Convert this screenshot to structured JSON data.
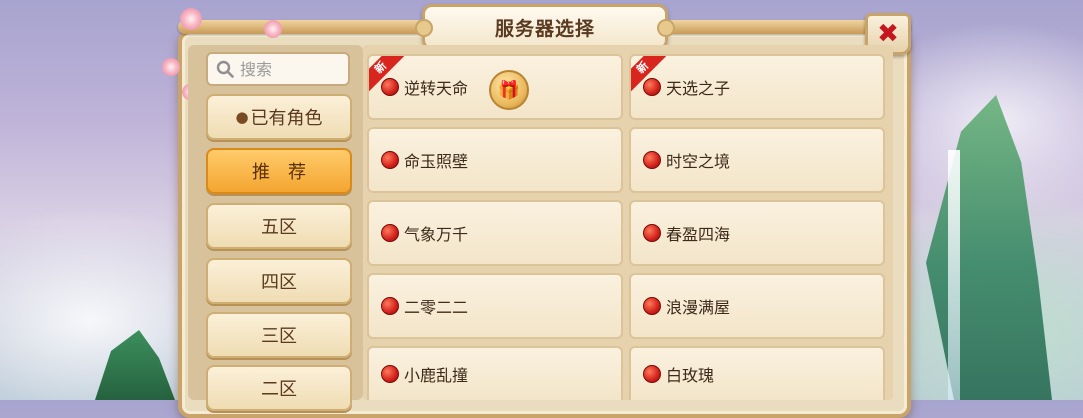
{
  "title": "服务器选择",
  "close_icon": "close-x-icon",
  "search": {
    "placeholder": "搜索",
    "icon": "search-icon"
  },
  "categories": [
    {
      "label": "已有角色",
      "icon": "user-icon",
      "active": false
    },
    {
      "label": "推　荐",
      "active": true
    },
    {
      "label": "五区",
      "active": false
    },
    {
      "label": "四区",
      "active": false
    },
    {
      "label": "三区",
      "active": false
    },
    {
      "label": "二区",
      "active": false
    }
  ],
  "servers": [
    {
      "name": "逆转天命",
      "new": true,
      "gift": true,
      "status": "red"
    },
    {
      "name": "天选之子",
      "new": true,
      "gift": false,
      "status": "red"
    },
    {
      "name": "命玉照壁",
      "new": false,
      "gift": false,
      "status": "red"
    },
    {
      "name": "时空之境",
      "new": false,
      "gift": false,
      "status": "red"
    },
    {
      "name": "气象万千",
      "new": false,
      "gift": false,
      "status": "red"
    },
    {
      "name": "春盈四海",
      "new": false,
      "gift": false,
      "status": "red"
    },
    {
      "name": "二零二二",
      "new": false,
      "gift": false,
      "status": "red"
    },
    {
      "name": "浪漫满屋",
      "new": false,
      "gift": false,
      "status": "red"
    },
    {
      "name": "小鹿乱撞",
      "new": false,
      "gift": false,
      "status": "red"
    },
    {
      "name": "白玫瑰",
      "new": false,
      "gift": false,
      "status": "red"
    }
  ],
  "new_tag": "新",
  "colors": {
    "status_red": "#d1201b",
    "active_tab": "#f4a531",
    "panel": "#eadcbf"
  }
}
